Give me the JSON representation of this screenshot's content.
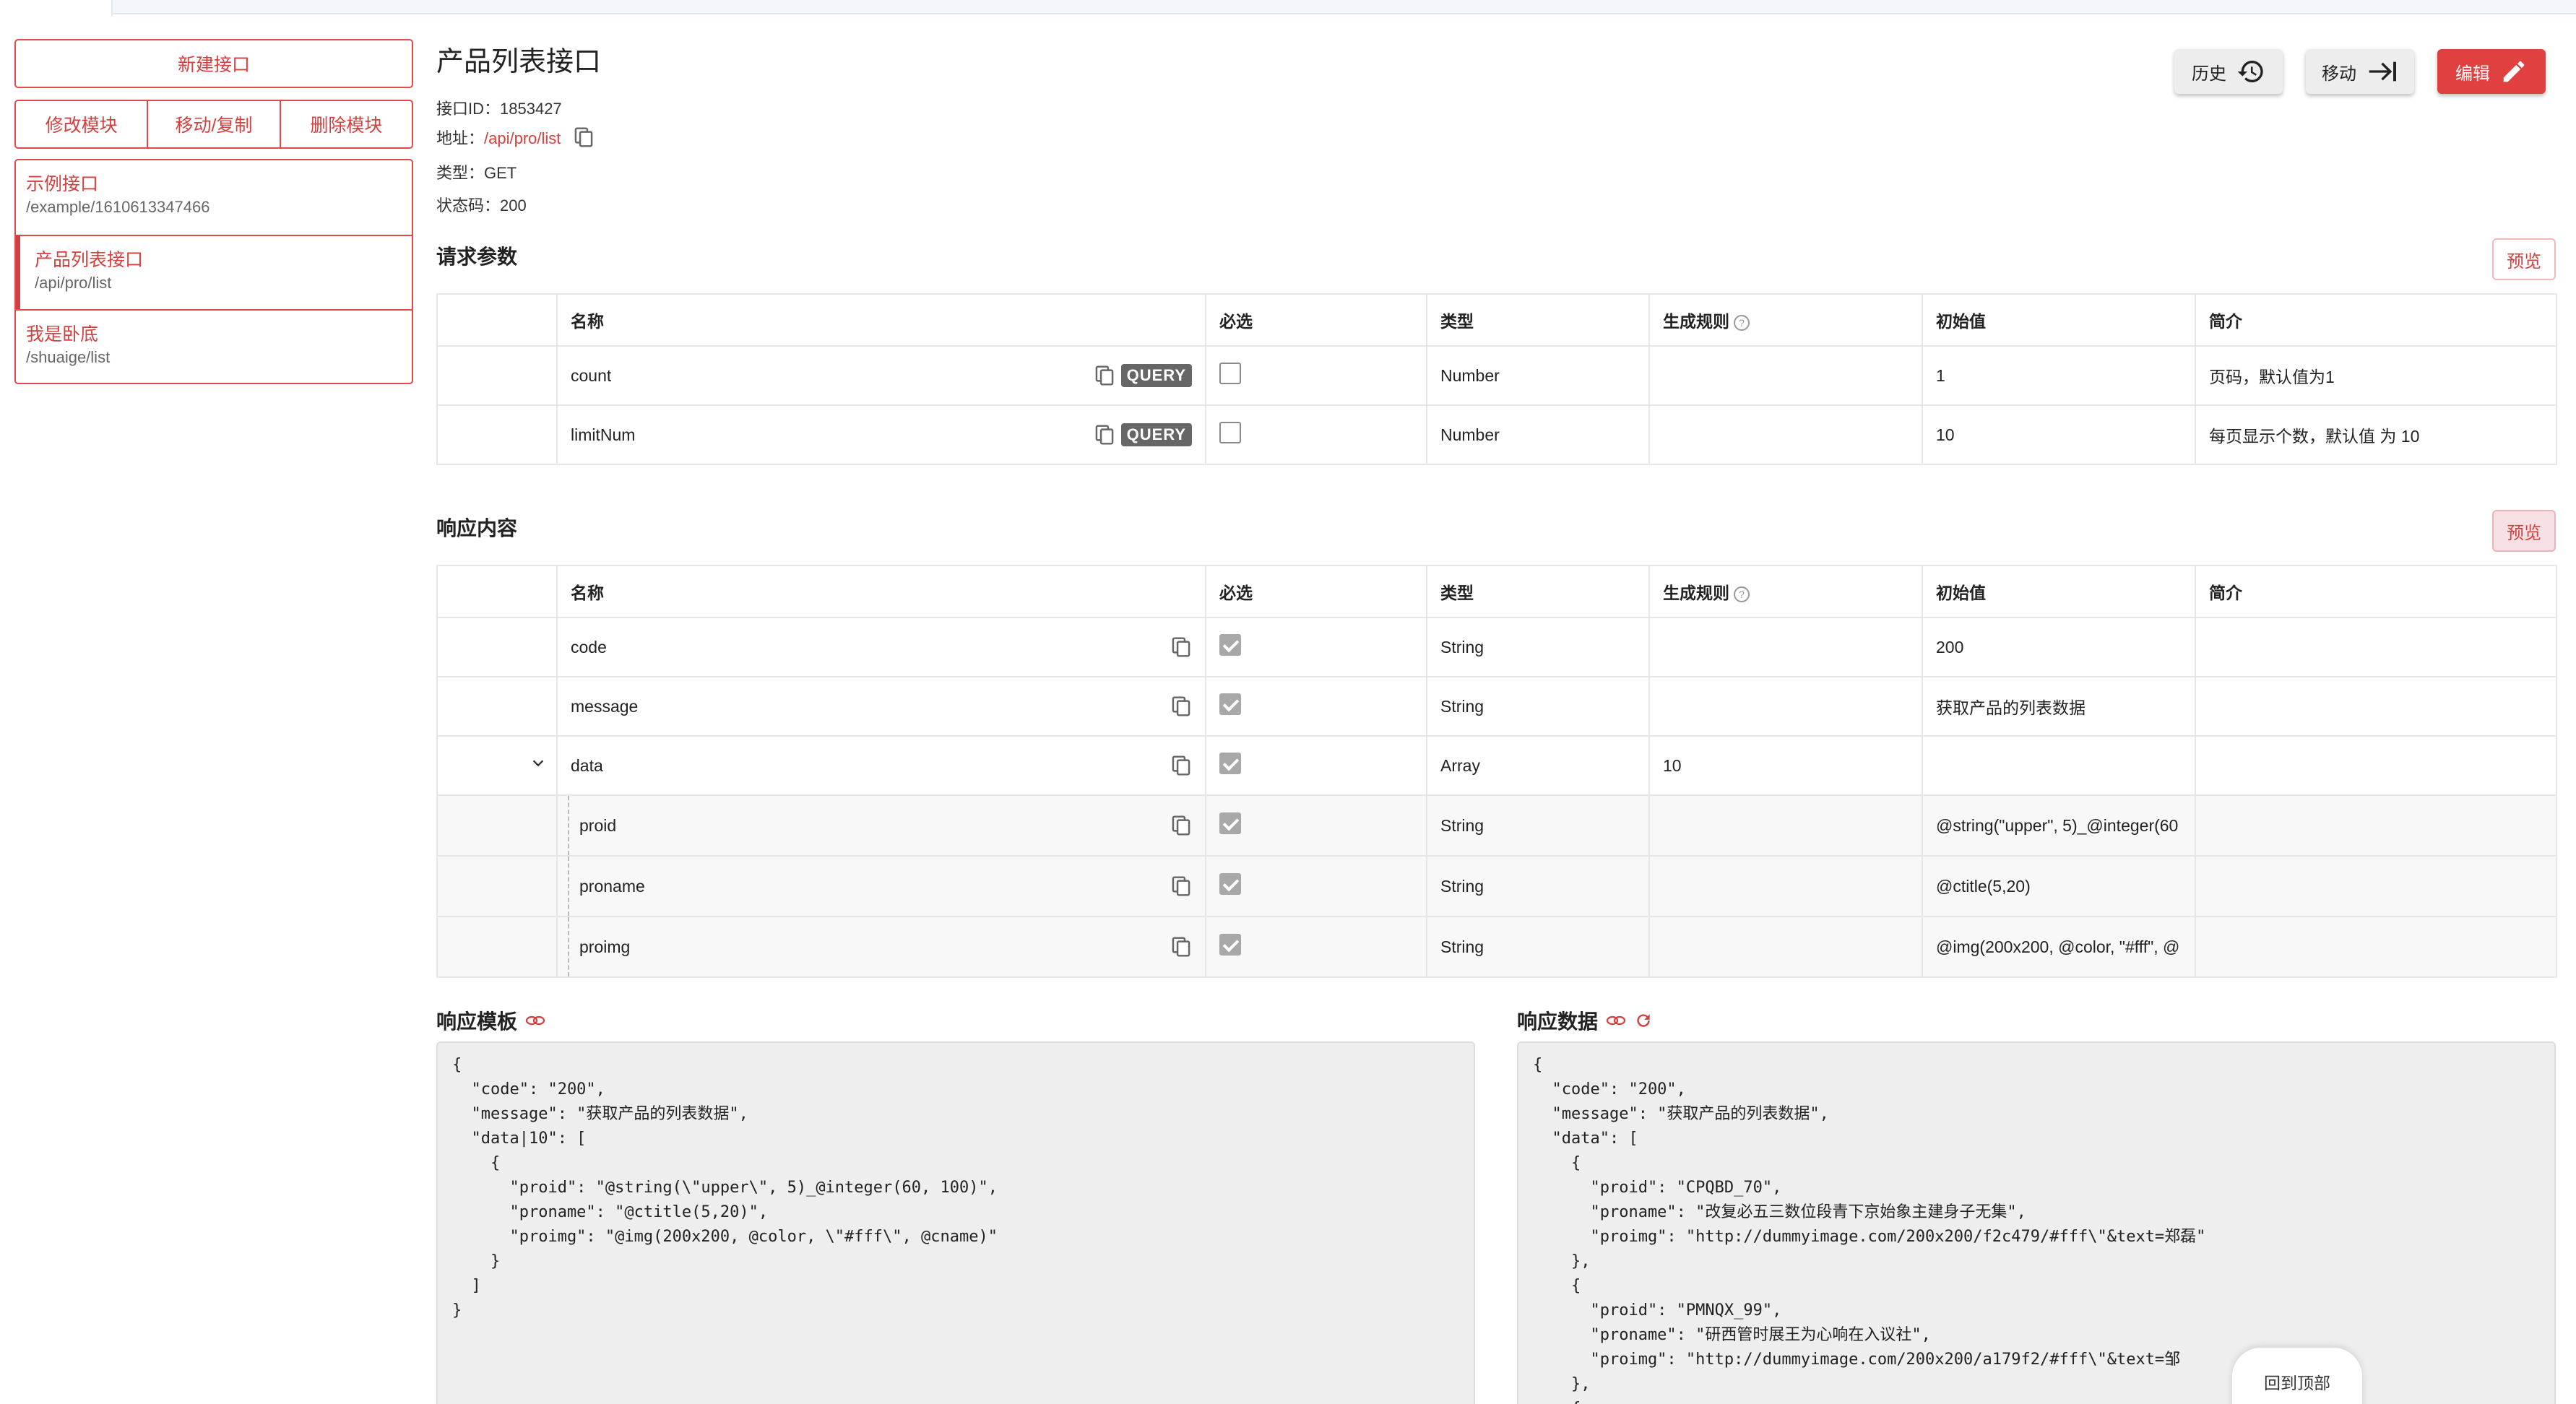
{
  "sidebar": {
    "new_label": "新建接口",
    "actions": [
      "修改模块",
      "移动/复制",
      "删除模块"
    ],
    "items": [
      {
        "title": "示例接口",
        "path": "/example/1610613347466"
      },
      {
        "title": "产品列表接口",
        "path": "/api/pro/list"
      },
      {
        "title": "我是卧底",
        "path": "/shuaige/list"
      }
    ]
  },
  "header": {
    "title": "产品列表接口",
    "id_label": "接口ID：",
    "id_value": "1853427",
    "addr_label": "地址：",
    "addr_value": "/api/pro/list",
    "type_label": "类型：",
    "type_value": "GET",
    "status_label": "状态码：",
    "status_value": "200",
    "buttons": {
      "history": "历史",
      "move": "移动",
      "edit": "编辑"
    }
  },
  "request": {
    "title": "请求参数",
    "preview": "预览",
    "columns": [
      "名称",
      "必选",
      "类型",
      "生成规则",
      "初始值",
      "简介"
    ],
    "rows": [
      {
        "name": "count",
        "tag": "QUERY",
        "type": "Number",
        "rule": "",
        "init": "1",
        "desc": "页码，默认值为1"
      },
      {
        "name": "limitNum",
        "tag": "QUERY",
        "type": "Number",
        "rule": "",
        "init": "10",
        "desc": "每页显示个数，默认值 为 10"
      }
    ]
  },
  "response": {
    "title": "响应内容",
    "preview": "预览",
    "columns": [
      "名称",
      "必选",
      "类型",
      "生成规则",
      "初始值",
      "简介"
    ],
    "rows": [
      {
        "name": "code",
        "type": "String",
        "rule": "",
        "init": "200",
        "desc": ""
      },
      {
        "name": "message",
        "type": "String",
        "rule": "",
        "init": "获取产品的列表数据",
        "desc": ""
      },
      {
        "name": "data",
        "type": "Array",
        "rule": "10",
        "init": "",
        "desc": ""
      },
      {
        "name": "proid",
        "type": "String",
        "rule": "",
        "init": "@string(\"upper\", 5)_@integer(60",
        "desc": ""
      },
      {
        "name": "proname",
        "type": "String",
        "rule": "",
        "init": "@ctitle(5,20)",
        "desc": ""
      },
      {
        "name": "proimg",
        "type": "String",
        "rule": "",
        "init": "@img(200x200, @color, \"#fff\", @",
        "desc": ""
      }
    ]
  },
  "template": {
    "title": "响应模板",
    "code": "{\n  \"code\": \"200\",\n  \"message\": \"获取产品的列表数据\",\n  \"data|10\": [\n    {\n      \"proid\": \"@string(\\\"upper\\\", 5)_@integer(60, 100)\",\n      \"proname\": \"@ctitle(5,20)\",\n      \"proimg\": \"@img(200x200, @color, \\\"#fff\\\", @cname)\"\n    }\n  ]\n}"
  },
  "data_panel": {
    "title": "响应数据",
    "code": "{\n  \"code\": \"200\",\n  \"message\": \"获取产品的列表数据\",\n  \"data\": [\n    {\n      \"proid\": \"CPQBD_70\",\n      \"proname\": \"改复必五三数位段青下京始象主建身子无集\",\n      \"proimg\": \"http://dummyimage.com/200x200/f2c479/#fff\\\"&text=郑磊\"\n    },\n    {\n      \"proid\": \"PMNQX_99\",\n      \"proname\": \"研西管时展王为心响在入议社\",\n      \"proimg\": \"http://dummyimage.com/200x200/a179f2/#fff\\\"&text=邹\n    },\n    {"
  },
  "back_to_top": "回到顶部"
}
